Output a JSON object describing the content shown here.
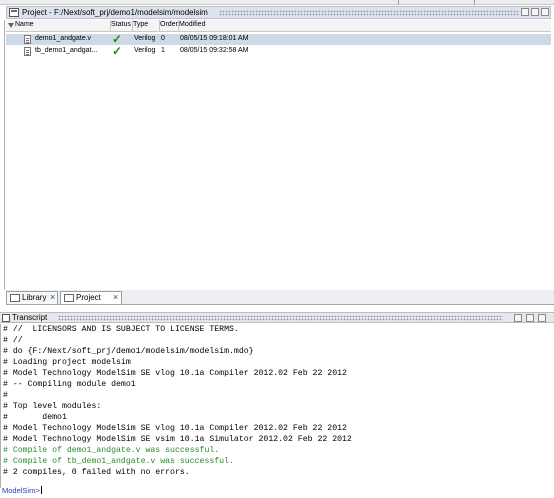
{
  "project_panel": {
    "title": "Project - F:/Next/soft_prj/demo1/modelsim/modelsim",
    "columns": [
      "Name",
      "Status",
      "Type",
      "Order",
      "Modified"
    ],
    "files": [
      {
        "name": "demo1_andgate.v",
        "type": "Verilog",
        "order": "0",
        "modified": "08/05/15 09:18:01 AM",
        "selected": true
      },
      {
        "name": "tb_demo1_andgat...",
        "type": "Verilog",
        "order": "1",
        "modified": "08/05/15 09:32:58 AM",
        "selected": false
      }
    ],
    "status_glyph": "✓"
  },
  "tabs": [
    {
      "label": "Library",
      "icon": "library-icon"
    },
    {
      "label": "Project",
      "icon": "project-icon",
      "active": true
    }
  ],
  "transcript": {
    "title": "Transcript",
    "lines": [
      {
        "text": "# //  LICENSORS AND IS SUBJECT TO LICENSE TERMS.",
        "style": "normal"
      },
      {
        "text": "# //",
        "style": "normal"
      },
      {
        "text": "# do {F:/Next/soft_prj/demo1/modelsim/modelsim.mdo}",
        "style": "normal"
      },
      {
        "text": "# Loading project modelsim",
        "style": "normal"
      },
      {
        "text": "# Model Technology ModelSim SE vlog 10.1a Compiler 2012.02 Feb 22 2012",
        "style": "normal"
      },
      {
        "text": "# -- Compiling module demo1",
        "style": "normal"
      },
      {
        "text": "#",
        "style": "normal"
      },
      {
        "text": "# Top level modules:",
        "style": "normal"
      },
      {
        "text": "#       demo1",
        "style": "normal"
      },
      {
        "text": "# Model Technology ModelSim SE vlog 10.1a Compiler 2012.02 Feb 22 2012",
        "style": "normal"
      },
      {
        "text": "# Model Technology ModelSim SE vsim 10.1a Simulator 2012.02 Feb 22 2012",
        "style": "normal"
      },
      {
        "text": "# Compile of demo1_andgate.v was successful.",
        "style": "green"
      },
      {
        "text": "# Compile of tb_demo1_andgate.v was successful.",
        "style": "green"
      },
      {
        "text": "# 2 compiles, 0 failed with no errors.",
        "style": "normal"
      }
    ],
    "prompt": "ModelSim>"
  },
  "colors": {
    "success": "#2a8a2a",
    "prompt": "#1f3fae",
    "selection": "#cdd9e6"
  }
}
